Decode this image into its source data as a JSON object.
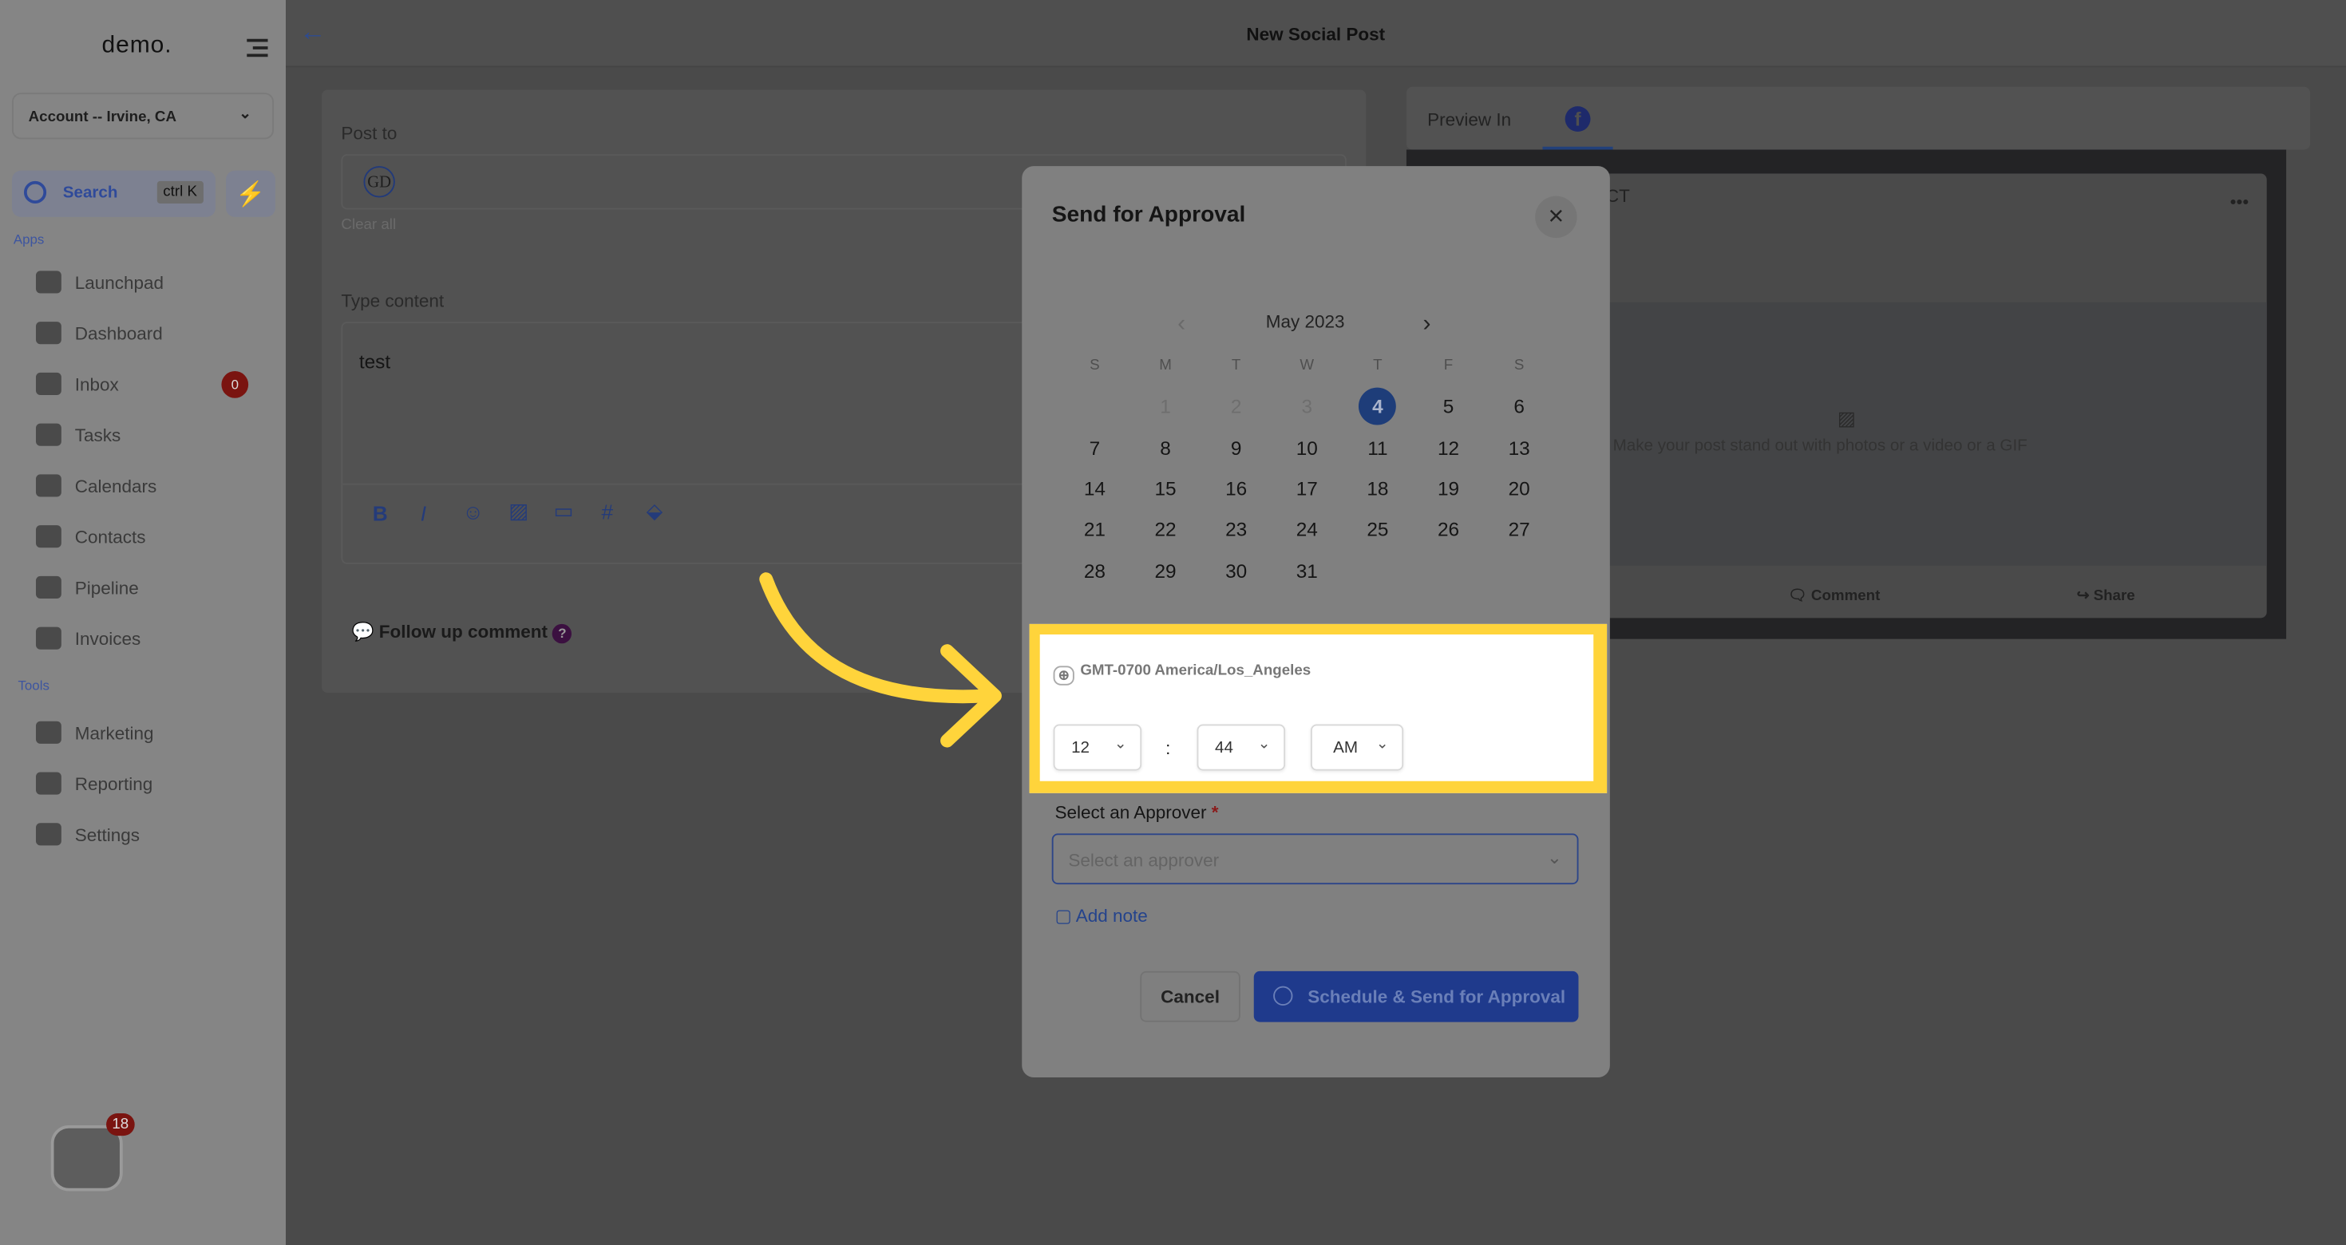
{
  "sidebar": {
    "logo": "demo.",
    "account": "Account -- Irvine, CA",
    "search_label": "Search",
    "search_shortcut": "ctrl K",
    "apps_heading": "Apps",
    "tools_heading": "Tools",
    "apps": [
      {
        "label": "Launchpad",
        "icon": "rocket-icon"
      },
      {
        "label": "Dashboard",
        "icon": "grid-icon"
      },
      {
        "label": "Inbox",
        "icon": "inbox-icon",
        "badge": "0"
      },
      {
        "label": "Tasks",
        "icon": "clipboard-icon"
      },
      {
        "label": "Calendars",
        "icon": "calendar-icon"
      },
      {
        "label": "Contacts",
        "icon": "person-icon"
      },
      {
        "label": "Pipeline",
        "icon": "funnel-icon"
      },
      {
        "label": "Invoices",
        "icon": "receipt-icon"
      }
    ],
    "tools": [
      {
        "label": "Marketing",
        "icon": "megaphone-icon"
      },
      {
        "label": "Reporting",
        "icon": "pie-icon"
      },
      {
        "label": "Settings",
        "icon": "gear-icon"
      }
    ],
    "chat_badge": "18"
  },
  "header": {
    "title": "New Social Post"
  },
  "composer": {
    "post_to_label": "Post to",
    "avatar_text": "GD",
    "clear_all": "Clear all",
    "content_label": "Type content",
    "content_value": "test",
    "follow_up": "Follow up comment"
  },
  "preview": {
    "tab_label": "Preview In",
    "page_name_fragment": "ICT",
    "media_hint": "Make your post stand out with photos or a video or a GIF",
    "comment": "Comment",
    "share": "Share"
  },
  "modal": {
    "title": "Send for Approval",
    "month": "May 2023",
    "weekdays": [
      "S",
      "M",
      "T",
      "W",
      "T",
      "F",
      "S"
    ],
    "weeks": [
      [
        "",
        "1",
        "2",
        "3",
        "4",
        "5",
        "6"
      ],
      [
        "7",
        "8",
        "9",
        "10",
        "11",
        "12",
        "13"
      ],
      [
        "14",
        "15",
        "16",
        "17",
        "18",
        "19",
        "20"
      ],
      [
        "21",
        "22",
        "23",
        "24",
        "25",
        "26",
        "27"
      ],
      [
        "28",
        "29",
        "30",
        "31",
        "",
        "",
        ""
      ]
    ],
    "disabled_days": [
      "1",
      "2",
      "3"
    ],
    "selected_day": "4",
    "timezone": "GMT-0700 America/Los_Angeles",
    "hour": "12",
    "minute": "44",
    "ampm": "AM",
    "colon": ":",
    "approver_label": "Select an Approver",
    "required_mark": "*",
    "approver_placeholder": "Select an approver",
    "add_note": "Add note",
    "cancel": "Cancel",
    "submit": "Schedule & Send for Approval"
  },
  "colors": {
    "highlight": "#ffd43b",
    "primary": "#1f3a8c",
    "badge": "#7a1410"
  }
}
